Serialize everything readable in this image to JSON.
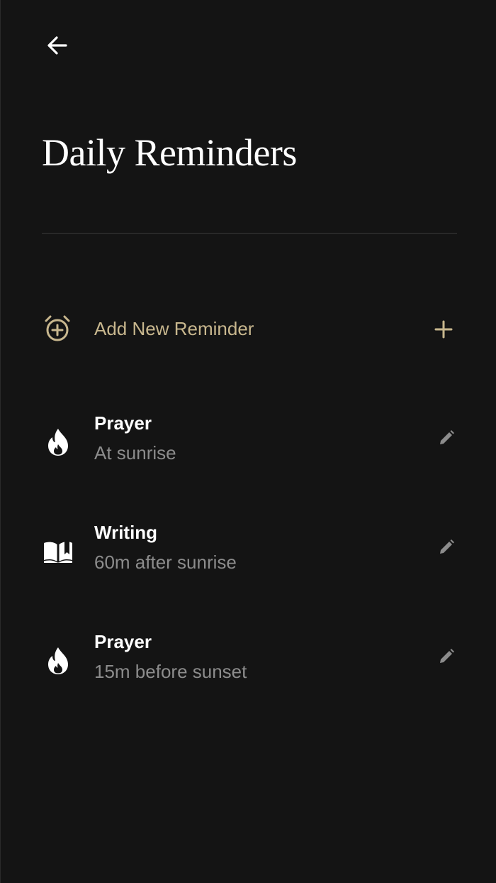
{
  "header": {
    "back_icon": "arrow-left-icon",
    "title": "Daily Reminders"
  },
  "add_reminder": {
    "icon": "alarm-plus-icon",
    "label": "Add New Reminder",
    "action_icon": "plus-icon"
  },
  "reminders": [
    {
      "icon": "flame-icon",
      "title": "Prayer",
      "subtitle": "At sunrise",
      "edit_icon": "pencil-icon"
    },
    {
      "icon": "open-book-icon",
      "title": "Writing",
      "subtitle": "60m after sunrise",
      "edit_icon": "pencil-icon"
    },
    {
      "icon": "flame-icon",
      "title": "Prayer",
      "subtitle": "15m before sunset",
      "edit_icon": "pencil-icon"
    }
  ],
  "colors": {
    "background": "#141414",
    "accent": "#c8b78e",
    "primary_text": "#ffffff",
    "secondary_text": "#8c8c8c",
    "divider": "#3a3a3a",
    "edit_icon": "#8c8c8c"
  }
}
